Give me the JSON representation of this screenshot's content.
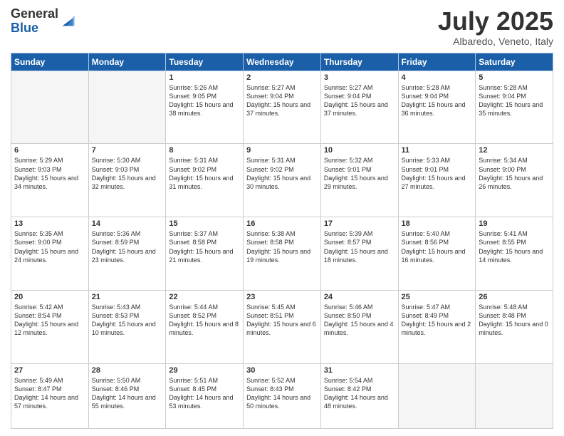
{
  "logo": {
    "general": "General",
    "blue": "Blue"
  },
  "title": "July 2025",
  "location": "Albaredo, Veneto, Italy",
  "weekdays": [
    "Sunday",
    "Monday",
    "Tuesday",
    "Wednesday",
    "Thursday",
    "Friday",
    "Saturday"
  ],
  "weeks": [
    [
      {
        "day": "",
        "empty": true
      },
      {
        "day": "",
        "empty": true
      },
      {
        "day": "1",
        "sunrise": "5:26 AM",
        "sunset": "9:05 PM",
        "daylight": "15 hours and 38 minutes."
      },
      {
        "day": "2",
        "sunrise": "5:27 AM",
        "sunset": "9:04 PM",
        "daylight": "15 hours and 37 minutes."
      },
      {
        "day": "3",
        "sunrise": "5:27 AM",
        "sunset": "9:04 PM",
        "daylight": "15 hours and 37 minutes."
      },
      {
        "day": "4",
        "sunrise": "5:28 AM",
        "sunset": "9:04 PM",
        "daylight": "15 hours and 36 minutes."
      },
      {
        "day": "5",
        "sunrise": "5:28 AM",
        "sunset": "9:04 PM",
        "daylight": "15 hours and 35 minutes."
      }
    ],
    [
      {
        "day": "6",
        "sunrise": "5:29 AM",
        "sunset": "9:03 PM",
        "daylight": "15 hours and 34 minutes."
      },
      {
        "day": "7",
        "sunrise": "5:30 AM",
        "sunset": "9:03 PM",
        "daylight": "15 hours and 32 minutes."
      },
      {
        "day": "8",
        "sunrise": "5:31 AM",
        "sunset": "9:02 PM",
        "daylight": "15 hours and 31 minutes."
      },
      {
        "day": "9",
        "sunrise": "5:31 AM",
        "sunset": "9:02 PM",
        "daylight": "15 hours and 30 minutes."
      },
      {
        "day": "10",
        "sunrise": "5:32 AM",
        "sunset": "9:01 PM",
        "daylight": "15 hours and 29 minutes."
      },
      {
        "day": "11",
        "sunrise": "5:33 AM",
        "sunset": "9:01 PM",
        "daylight": "15 hours and 27 minutes."
      },
      {
        "day": "12",
        "sunrise": "5:34 AM",
        "sunset": "9:00 PM",
        "daylight": "15 hours and 26 minutes."
      }
    ],
    [
      {
        "day": "13",
        "sunrise": "5:35 AM",
        "sunset": "9:00 PM",
        "daylight": "15 hours and 24 minutes."
      },
      {
        "day": "14",
        "sunrise": "5:36 AM",
        "sunset": "8:59 PM",
        "daylight": "15 hours and 23 minutes."
      },
      {
        "day": "15",
        "sunrise": "5:37 AM",
        "sunset": "8:58 PM",
        "daylight": "15 hours and 21 minutes."
      },
      {
        "day": "16",
        "sunrise": "5:38 AM",
        "sunset": "8:58 PM",
        "daylight": "15 hours and 19 minutes."
      },
      {
        "day": "17",
        "sunrise": "5:39 AM",
        "sunset": "8:57 PM",
        "daylight": "15 hours and 18 minutes."
      },
      {
        "day": "18",
        "sunrise": "5:40 AM",
        "sunset": "8:56 PM",
        "daylight": "15 hours and 16 minutes."
      },
      {
        "day": "19",
        "sunrise": "5:41 AM",
        "sunset": "8:55 PM",
        "daylight": "15 hours and 14 minutes."
      }
    ],
    [
      {
        "day": "20",
        "sunrise": "5:42 AM",
        "sunset": "8:54 PM",
        "daylight": "15 hours and 12 minutes."
      },
      {
        "day": "21",
        "sunrise": "5:43 AM",
        "sunset": "8:53 PM",
        "daylight": "15 hours and 10 minutes."
      },
      {
        "day": "22",
        "sunrise": "5:44 AM",
        "sunset": "8:52 PM",
        "daylight": "15 hours and 8 minutes."
      },
      {
        "day": "23",
        "sunrise": "5:45 AM",
        "sunset": "8:51 PM",
        "daylight": "15 hours and 6 minutes."
      },
      {
        "day": "24",
        "sunrise": "5:46 AM",
        "sunset": "8:50 PM",
        "daylight": "15 hours and 4 minutes."
      },
      {
        "day": "25",
        "sunrise": "5:47 AM",
        "sunset": "8:49 PM",
        "daylight": "15 hours and 2 minutes."
      },
      {
        "day": "26",
        "sunrise": "5:48 AM",
        "sunset": "8:48 PM",
        "daylight": "15 hours and 0 minutes."
      }
    ],
    [
      {
        "day": "27",
        "sunrise": "5:49 AM",
        "sunset": "8:47 PM",
        "daylight": "14 hours and 57 minutes."
      },
      {
        "day": "28",
        "sunrise": "5:50 AM",
        "sunset": "8:46 PM",
        "daylight": "14 hours and 55 minutes."
      },
      {
        "day": "29",
        "sunrise": "5:51 AM",
        "sunset": "8:45 PM",
        "daylight": "14 hours and 53 minutes."
      },
      {
        "day": "30",
        "sunrise": "5:52 AM",
        "sunset": "8:43 PM",
        "daylight": "14 hours and 50 minutes."
      },
      {
        "day": "31",
        "sunrise": "5:54 AM",
        "sunset": "8:42 PM",
        "daylight": "14 hours and 48 minutes."
      },
      {
        "day": "",
        "empty": true
      },
      {
        "day": "",
        "empty": true
      }
    ]
  ]
}
